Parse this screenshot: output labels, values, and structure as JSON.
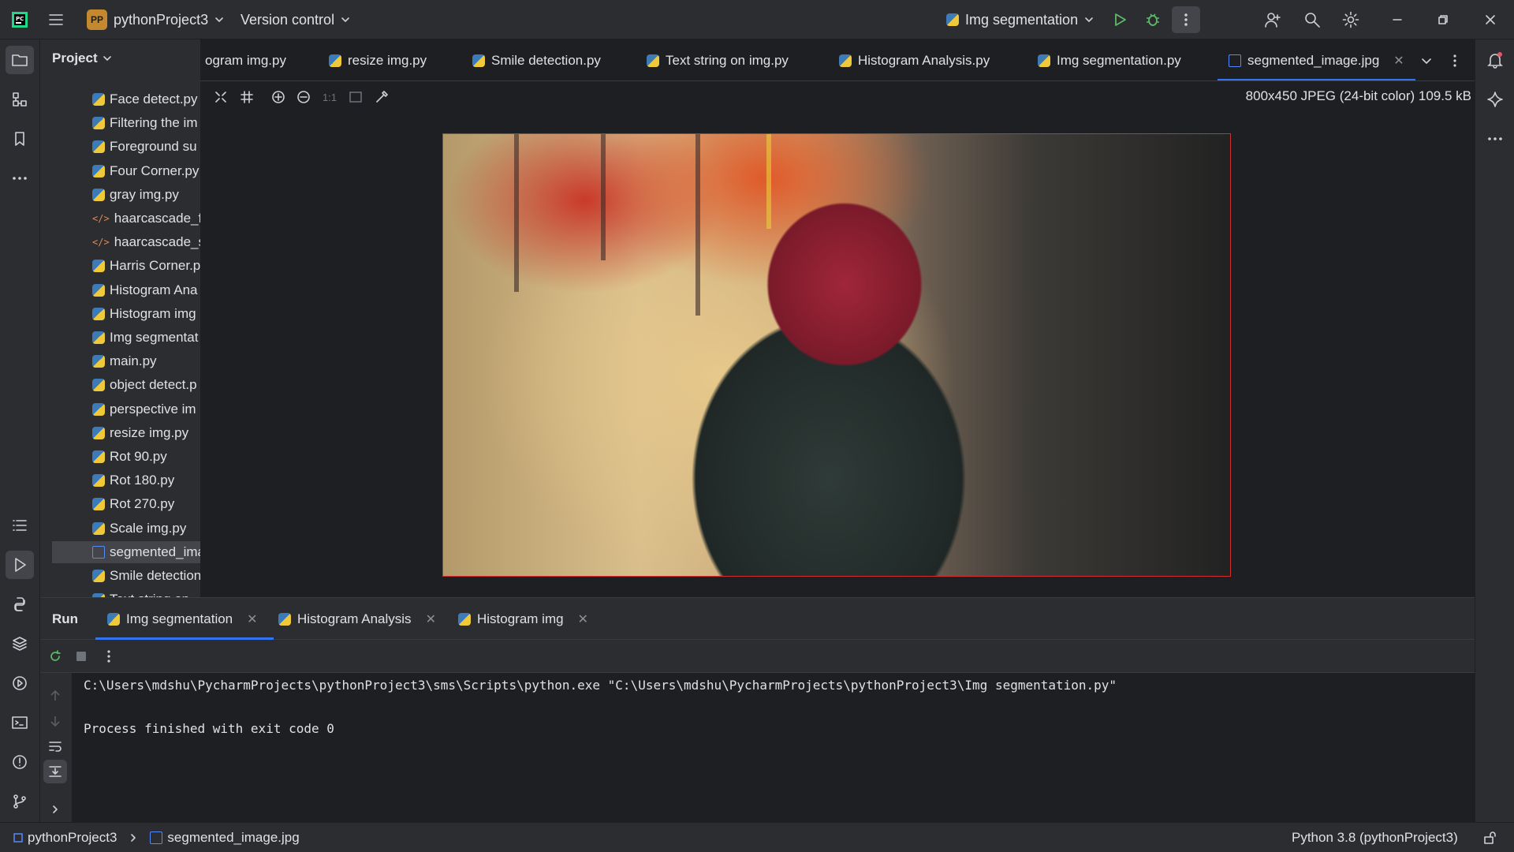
{
  "titlebar": {
    "project_badge": "PP",
    "project_name": "pythonProject3",
    "vcs_label": "Version control",
    "run_config": "Img segmentation"
  },
  "project_panel": {
    "title": "Project",
    "items": [
      {
        "label": "Face detect.py",
        "type": "py"
      },
      {
        "label": "Filtering the im",
        "type": "py"
      },
      {
        "label": "Foreground su",
        "type": "py"
      },
      {
        "label": "Four Corner.py",
        "type": "py"
      },
      {
        "label": "gray img.py",
        "type": "py"
      },
      {
        "label": "haarcascade_fr",
        "type": "xml"
      },
      {
        "label": "haarcascade_s",
        "type": "xml"
      },
      {
        "label": "Harris Corner.p",
        "type": "py"
      },
      {
        "label": "Histogram Ana",
        "type": "py"
      },
      {
        "label": "Histogram img",
        "type": "py"
      },
      {
        "label": "Img segmentat",
        "type": "py"
      },
      {
        "label": "main.py",
        "type": "py"
      },
      {
        "label": "object detect.p",
        "type": "py"
      },
      {
        "label": "perspective im",
        "type": "py"
      },
      {
        "label": "resize img.py",
        "type": "py"
      },
      {
        "label": "Rot 90.py",
        "type": "py"
      },
      {
        "label": "Rot 180.py",
        "type": "py"
      },
      {
        "label": "Rot 270.py",
        "type": "py"
      },
      {
        "label": "Scale img.py",
        "type": "py"
      },
      {
        "label": "segmented_ima",
        "type": "img"
      },
      {
        "label": "Smile detection",
        "type": "py"
      },
      {
        "label": "Text string on",
        "type": "py"
      }
    ]
  },
  "tabs": [
    {
      "label": "ogram img.py"
    },
    {
      "label": "resize img.py"
    },
    {
      "label": "Smile detection.py"
    },
    {
      "label": "Text string on img.py"
    },
    {
      "label": "Histogram Analysis.py"
    },
    {
      "label": "Img segmentation.py"
    },
    {
      "label": "segmented_image.jpg"
    }
  ],
  "image_viewer": {
    "zoom_actual": "1:1",
    "info": "800x450 JPEG (24-bit color) 109.5 kB"
  },
  "run_panel": {
    "title": "Run",
    "tabs": [
      {
        "label": "Img segmentation"
      },
      {
        "label": "Histogram Analysis"
      },
      {
        "label": "Histogram img"
      }
    ],
    "console": {
      "command": "C:\\Users\\mdshu\\PycharmProjects\\pythonProject3\\sms\\Scripts\\python.exe \"C:\\Users\\mdshu\\PycharmProjects\\pythonProject3\\Img segmentation.py\"",
      "exit_message": "Process finished with exit code 0"
    }
  },
  "statusbar": {
    "breadcrumb_project": "pythonProject3",
    "breadcrumb_file": "segmented_image.jpg",
    "interpreter": "Python 3.8 (pythonProject3)"
  },
  "colors": {
    "accent": "#3574f0",
    "run_green": "#5fb865",
    "debug_green": "#5fb865",
    "image_border": "#d12f2f"
  }
}
